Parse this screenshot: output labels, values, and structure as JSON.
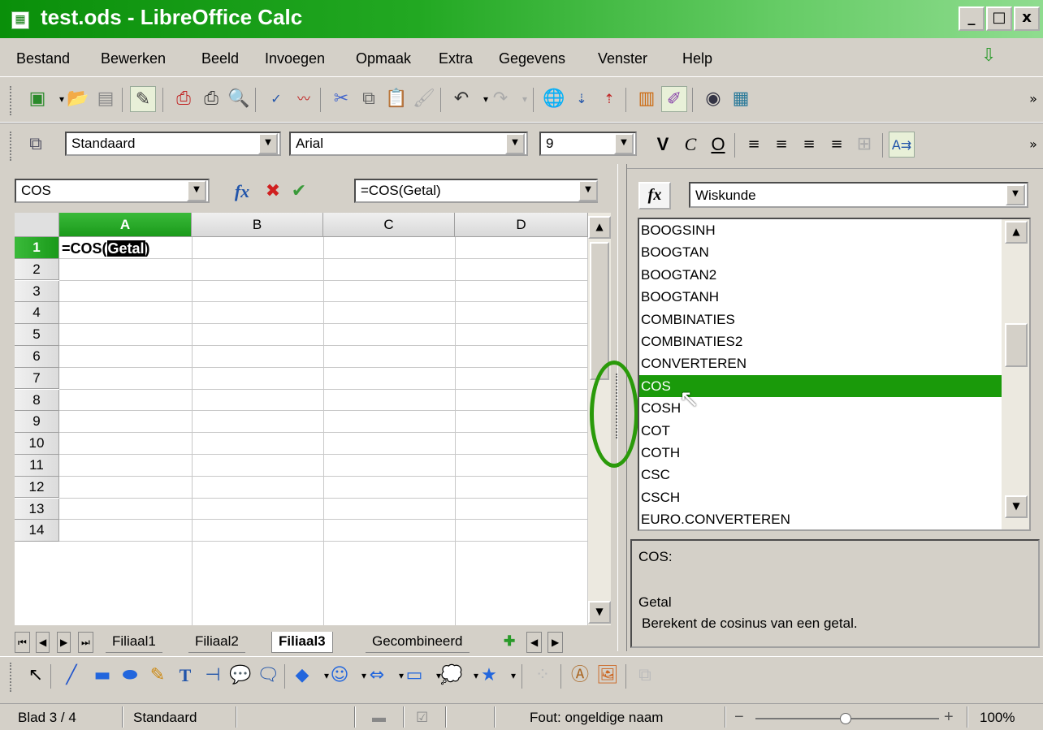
{
  "window": {
    "title": "test.ods - LibreOffice Calc",
    "min_label": "_",
    "max_label": "□",
    "close_label": "x"
  },
  "menu": [
    "Bestand",
    "Bewerken",
    "Beeld",
    "Invoegen",
    "Opmaak",
    "Extra",
    "Gegevens",
    "Venster",
    "Help"
  ],
  "format_bar": {
    "style": "Standaard",
    "font": "Arial",
    "size": "9",
    "bold": "V",
    "italic": "C",
    "underline": "O"
  },
  "formula_bar": {
    "name_box": "COS",
    "formula": "=COS(Getal)"
  },
  "sheet": {
    "columns": [
      "A",
      "B",
      "C",
      "D"
    ],
    "rows": [
      "1",
      "2",
      "3",
      "4",
      "5",
      "6",
      "7",
      "8",
      "9",
      "10",
      "11",
      "12",
      "13",
      "14"
    ],
    "cell_a1_prefix": "=COS(",
    "cell_a1_selected": "Getal",
    "cell_a1_suffix": ")"
  },
  "tabs": [
    "Filiaal1",
    "Filiaal2",
    "Filiaal3",
    "Gecombineerd"
  ],
  "active_tab": "Filiaal3",
  "function_wizard": {
    "category": "Wiskunde",
    "fx_label": "fx",
    "functions": [
      "BOOGSINH",
      "BOOGTAN",
      "BOOGTAN2",
      "BOOGTANH",
      "COMBINATIES",
      "COMBINATIES2",
      "CONVERTEREN",
      "COS",
      "COSH",
      "COT",
      "COTH",
      "CSC",
      "CSCH",
      "EURO.CONVERTEREN"
    ],
    "selected": "COS",
    "desc_name": "COS:",
    "desc_arg": "Getal",
    "desc_text": "Berekent de cosinus van een getal."
  },
  "status": {
    "sheet": "Blad 3 / 4",
    "style": "Standaard",
    "message": "Fout: ongeldige naam",
    "zoom": "100%"
  },
  "colors": {
    "accent": "#0a8f0a",
    "selection": "#1a9a0a",
    "highlight_ring": "#2a9a0a"
  }
}
